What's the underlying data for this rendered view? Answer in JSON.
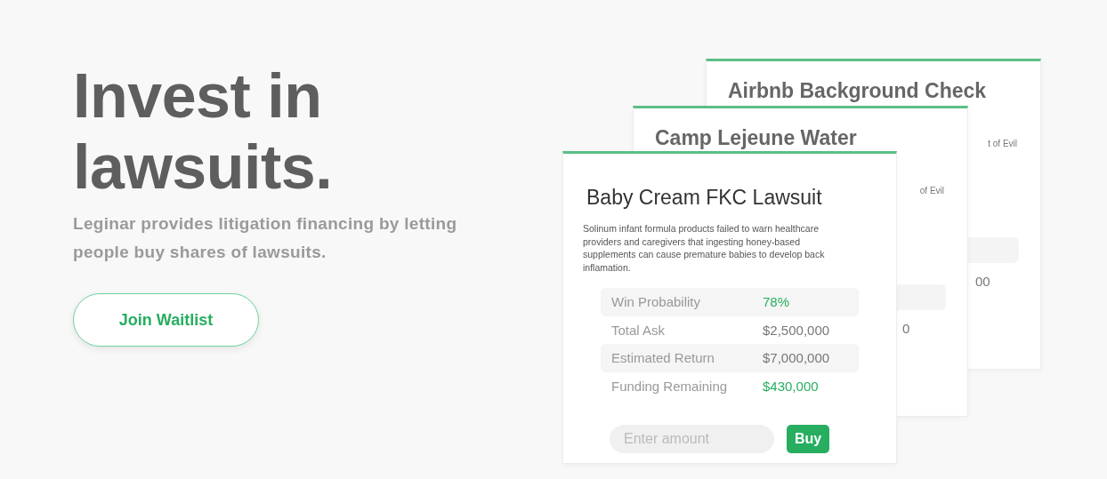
{
  "hero": {
    "title_lines": [
      "Invest in",
      "lawsuits."
    ],
    "subtitle": "Leginar provides litigation financing by letting people buy shares of lawsuits.",
    "cta": "Join Waitlist"
  },
  "background_cards": [
    {
      "title": "Airbnb Background Check",
      "description_fragment": "t of Evil",
      "value_fragment": "00"
    },
    {
      "title": "Camp Lejeune Water",
      "description_fragment": "of Evil",
      "value_fragment": "0"
    }
  ],
  "card": {
    "title": "Baby Cream FKC Lawsuit",
    "description": "Solinum infant formula products failed to warn healthcare providers and caregivers that ingesting honey-based supplements can cause premature babies to develop back inflamation.",
    "stats": [
      {
        "label": "Win Probability",
        "value": "78%",
        "kind": "positive"
      },
      {
        "label": "Total Ask",
        "value": "$2,500,000",
        "kind": "neutral"
      },
      {
        "label": "Estimated Return",
        "value": "$7,000,000",
        "kind": "neutral"
      },
      {
        "label": "Funding Remaining",
        "value": "$430,000",
        "kind": "positive"
      }
    ],
    "amount": {
      "placeholder": "Enter amount"
    },
    "buy": "Buy"
  }
}
